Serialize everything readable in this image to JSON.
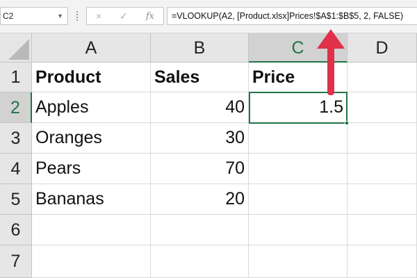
{
  "formula_bar": {
    "name_box": "C2",
    "cancel_icon": "×",
    "enter_icon": "✓",
    "function_icon": "fx",
    "formula": "=VLOOKUP(A2, [Product.xlsx]Prices!$A$1:$B$5, 2, FALSE)"
  },
  "grid": {
    "columns": [
      "A",
      "B",
      "C",
      "D"
    ],
    "selected_column": "C",
    "rows": [
      "1",
      "2",
      "3",
      "4",
      "5",
      "6",
      "7"
    ],
    "selected_row": "2",
    "cells": {
      "A1": "Product",
      "B1": "Sales",
      "C1": "Price",
      "A2": "Apples",
      "B2": "40",
      "C2": "1.5",
      "A3": "Oranges",
      "B3": "30",
      "A4": "Pears",
      "B4": "70",
      "A5": "Bananas",
      "B5": "20"
    },
    "active_cell": "C2"
  },
  "colors": {
    "accent_green": "#217346",
    "arrow_red": "#e0304a"
  },
  "annotation": {
    "icon": "arrow-up-icon"
  }
}
